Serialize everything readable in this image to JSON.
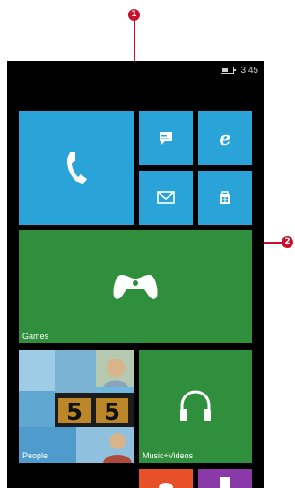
{
  "callouts": {
    "status_bar": "1",
    "tile": "2"
  },
  "status_bar": {
    "time": "3:45",
    "battery_icon": "battery-icon"
  },
  "tiles": {
    "phone": {
      "label": "",
      "icon": "phone-icon"
    },
    "messaging": {
      "label": "",
      "icon": "messaging-icon"
    },
    "internet_explorer": {
      "label": "",
      "icon": "internet-explorer-icon"
    },
    "email": {
      "label": "",
      "icon": "email-icon"
    },
    "store": {
      "label": "",
      "icon": "store-icon"
    },
    "games": {
      "label": "Games",
      "icon": "controller-icon"
    },
    "people": {
      "label": "People"
    },
    "music_videos": {
      "label": "Music+Videos",
      "icon": "headphones-icon"
    }
  },
  "colors": {
    "blue_tile": "#2aa3d8",
    "green_tile": "#2f8f3c",
    "callout": "#c8102e",
    "screen_background": "#000000"
  }
}
